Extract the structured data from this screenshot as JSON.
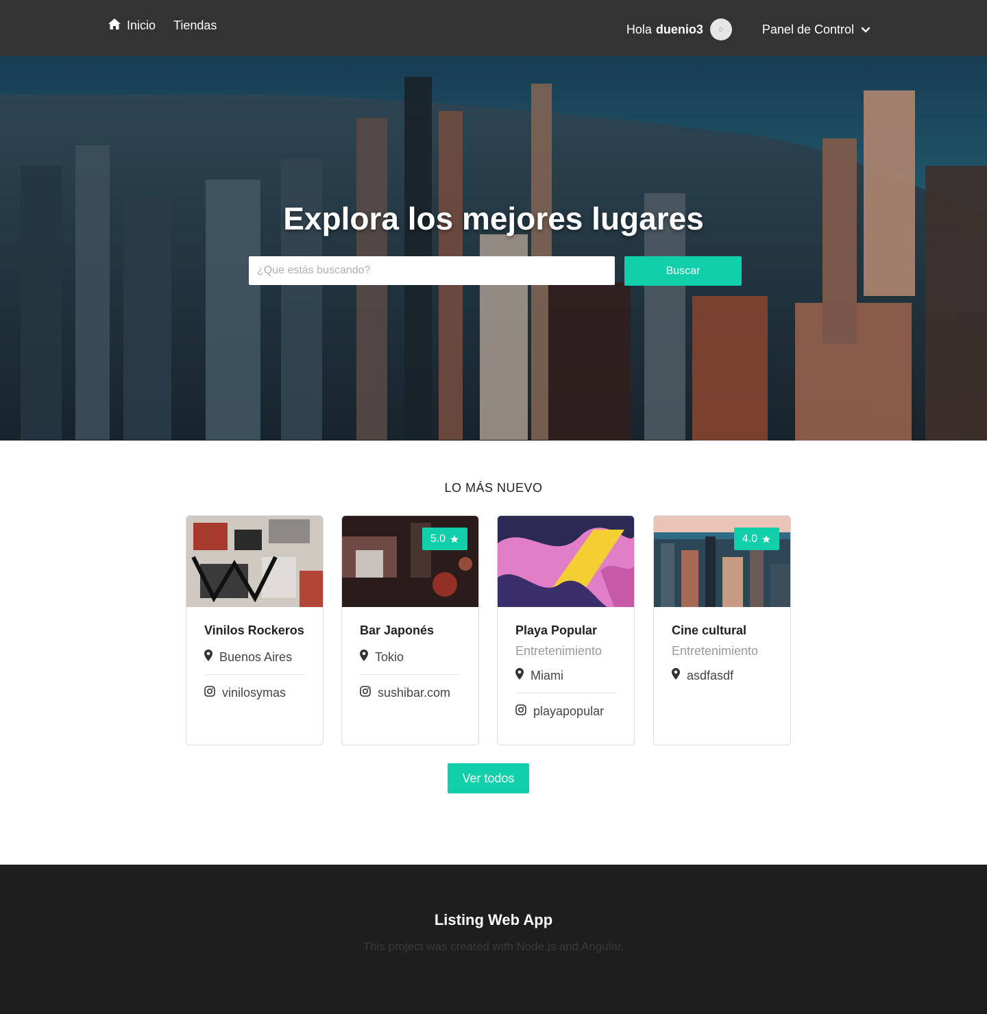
{
  "navbar": {
    "home_label": "Inicio",
    "stores_label": "Tiendas",
    "greeting_prefix": "Hola",
    "username": "duenio3",
    "avatar_initial": "D",
    "panel_label": "Panel de Control"
  },
  "hero": {
    "title": "Explora los mejores lugares",
    "search_placeholder": "¿Que estás buscando?",
    "search_button": "Buscar"
  },
  "section": {
    "title": "LO MÁS NUEVO",
    "view_all": "Ver todos"
  },
  "cards": [
    {
      "name": "Vinilos Rockeros",
      "category": "",
      "location": "Buenos Aires",
      "web": "vinilosymas",
      "rating": ""
    },
    {
      "name": "Bar Japonés",
      "category": "",
      "location": "Tokio",
      "web": "sushibar.com",
      "rating": "5.0"
    },
    {
      "name": "Playa Popular",
      "category": "Entretenimiento",
      "location": "Miami",
      "web": "playapopular",
      "rating": ""
    },
    {
      "name": "Cine cultural",
      "category": "Entretenimiento",
      "location": "asdfasdf",
      "web": "",
      "rating": "4.0"
    }
  ],
  "footer": {
    "title": "Listing Web App",
    "subtitle": "This project was created with Node.js and Angular."
  },
  "colors": {
    "accent": "#12cfab",
    "navbar": "#333333",
    "footer": "#1e1e1e"
  }
}
